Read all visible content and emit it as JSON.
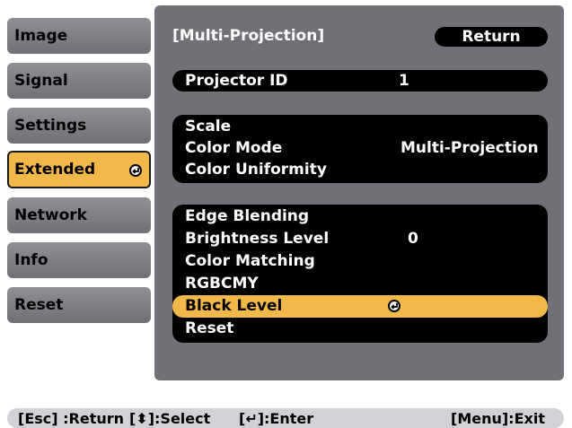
{
  "sidebar": {
    "items": [
      {
        "label": "Image"
      },
      {
        "label": "Signal"
      },
      {
        "label": "Settings"
      },
      {
        "label": "Extended",
        "active": true
      },
      {
        "label": "Network"
      },
      {
        "label": "Info"
      },
      {
        "label": "Reset"
      }
    ]
  },
  "header": {
    "title": "[Multi-Projection]",
    "return_label": "Return"
  },
  "groups": {
    "projector": {
      "label": "Projector ID",
      "value": "1"
    },
    "scale_group": [
      {
        "label": "Scale",
        "value": ""
      },
      {
        "label": "Color Mode",
        "value": "Multi-Projection"
      },
      {
        "label": "Color Uniformity",
        "value": ""
      }
    ],
    "edge_group": [
      {
        "label": "Edge Blending",
        "value": ""
      },
      {
        "label": "Brightness Level",
        "value": "0"
      },
      {
        "label": "Color Matching",
        "value": ""
      },
      {
        "label": "RGBCMY",
        "value": ""
      },
      {
        "label": "Black Level",
        "value": "",
        "selected": true
      },
      {
        "label": "Reset",
        "value": ""
      }
    ]
  },
  "footer": {
    "esc": "[Esc] :Return",
    "select": "[⬍]:Select",
    "enter": "[↵]:Enter",
    "menu": "[Menu]:Exit"
  },
  "colors": {
    "accent": "#f2b84a",
    "panel": "#6f7176",
    "pill": "#000000",
    "sidebar": "#7e8086"
  },
  "icons": {
    "enter": "enter-icon",
    "select": "up-down-arrow-icon"
  }
}
